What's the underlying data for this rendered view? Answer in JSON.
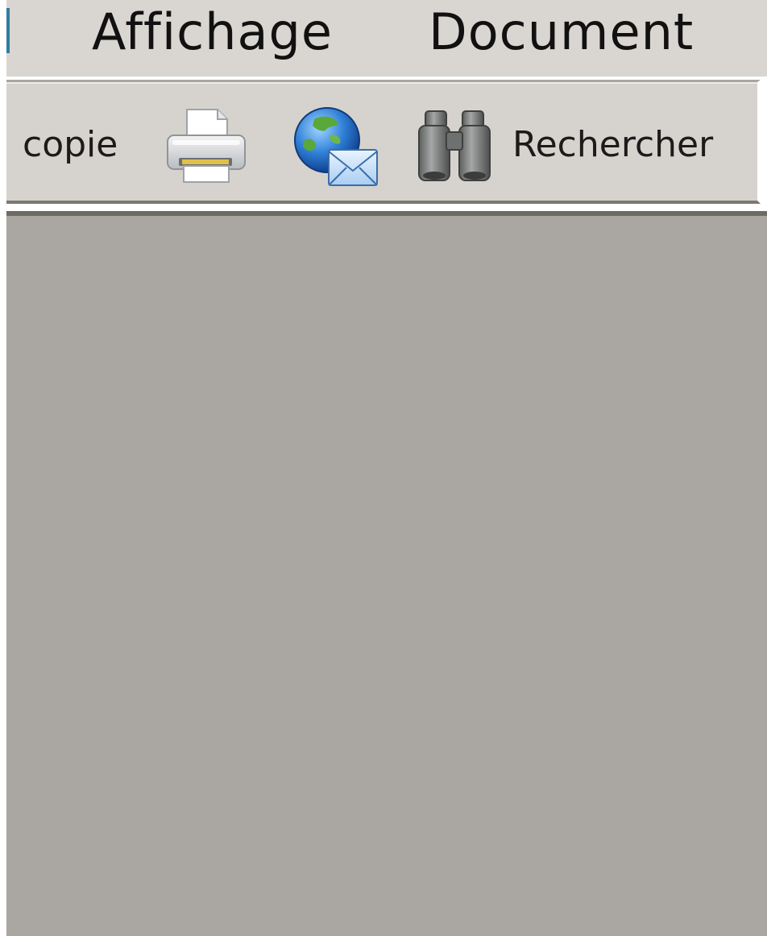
{
  "menubar": {
    "items": [
      {
        "label": "Affichage"
      },
      {
        "label": "Document"
      }
    ]
  },
  "toolbar": {
    "copy_label": "copie",
    "search_label": "Rechercher",
    "icons": {
      "print": "printer-icon",
      "email": "globe-mail-icon",
      "search": "binoculars-icon"
    }
  },
  "colors": {
    "menubar_bg": "#d9d5d0",
    "toolbar_bg": "#d6d2cd",
    "document_bg": "#aaa6a1"
  }
}
